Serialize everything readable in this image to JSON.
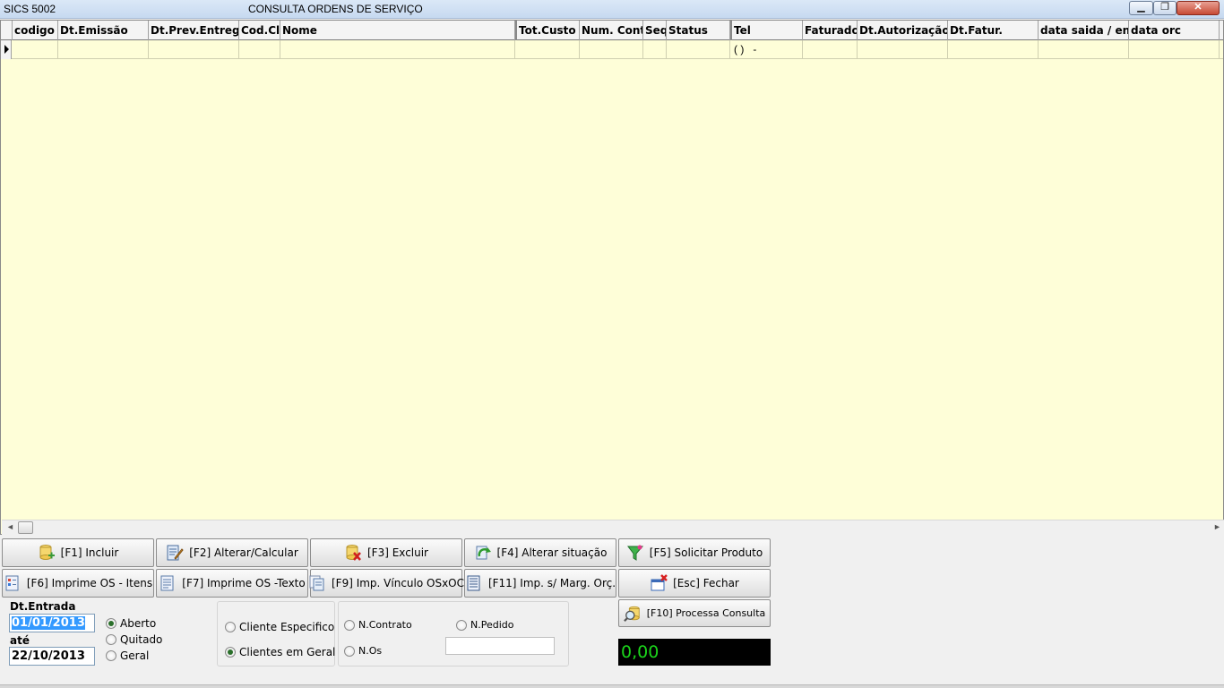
{
  "window": {
    "app_label": "SICS 5002",
    "caption": "CONSULTA ORDENS DE SERVIÇO",
    "min_glyph": "▁",
    "max_glyph": "❐",
    "close_glyph": "✕"
  },
  "grid": {
    "columns": [
      "codigo",
      "Dt.Emissão",
      "Dt.Prev.Entreg",
      "Cod.Cli",
      "Nome",
      "Tot.Custo",
      "Num. Cont",
      "Seq",
      "Status",
      "Tel",
      "Faturado",
      "Dt.Autorização",
      "Dt.Fatur.",
      "data saida / en",
      "data orc"
    ],
    "row": {
      "tel": "( )   -"
    }
  },
  "scroll": {
    "left_arrow": "◄",
    "right_arrow": "►"
  },
  "buttons": {
    "incluir": "[F1] Incluir",
    "alterar": "[F2] Alterar/Calcular",
    "excluir": "[F3] Excluir",
    "alterar_situacao": "[F4] Alterar situação",
    "solicitar_produto": "[F5] Solicitar Produto",
    "imprime_itens": "[F6] Imprime OS - Itens",
    "imprime_texto": "[F7] Imprime OS -Texto",
    "imp_vinculo": "[F9] Imp. Vínculo OSxOC",
    "imp_marg": "[F11] Imp. s/ Marg. Orç.",
    "fechar": "[Esc] Fechar",
    "processa": "[F10] Processa Consulta"
  },
  "filters": {
    "dt_entrada_label": "Dt.Entrada",
    "date_from": "01/01/2013",
    "ate_label": "até",
    "date_to": "22/10/2013",
    "status_options": [
      "Aberto",
      "Quitado",
      "Geral"
    ],
    "cliente_options": [
      "Cliente Especifico",
      "Clientes em Geral"
    ],
    "n_contrato": "N.Contrato",
    "n_pedido": "N.Pedido",
    "n_os": "N.Os"
  },
  "total_display": "0,00",
  "colors": {
    "grid_bg": "#fefed8",
    "display_bg": "#000000",
    "display_fg": "#1bd51b"
  }
}
